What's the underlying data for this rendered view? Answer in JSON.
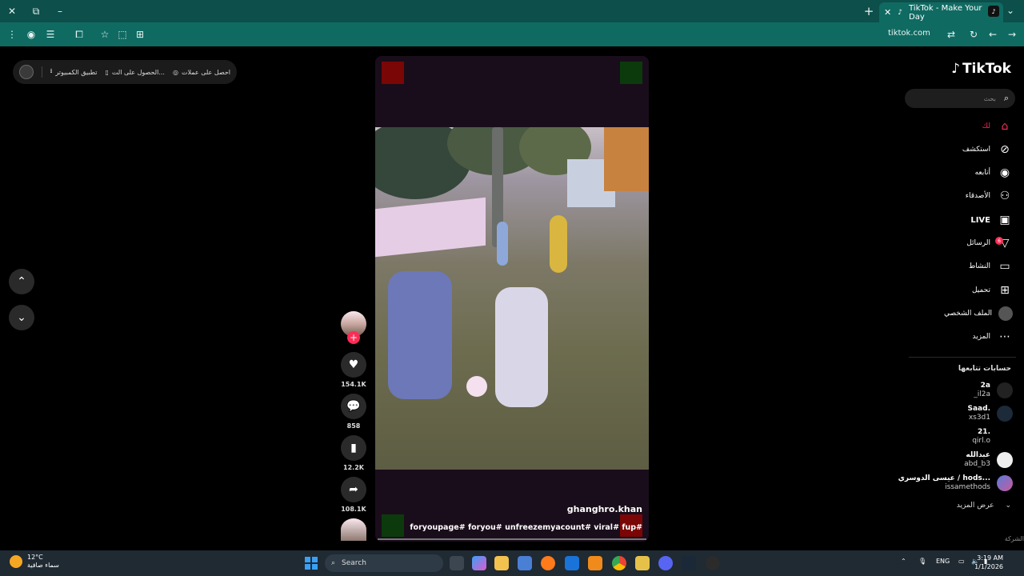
{
  "browser": {
    "tab_title": "TikTok - Make Your Day",
    "url": "tiktok.com"
  },
  "top_pill": {
    "item1": "احصل على عملات",
    "item2": "الحصول على الت...",
    "item3": "تطبيق الكمبيوتر"
  },
  "video": {
    "username": "ghanghro.khan",
    "caption": "foryoupage# foryou# unfreezemyacount# viral# fup#"
  },
  "actions": {
    "likes": "154.1K",
    "comments": "858",
    "saves": "12.2K",
    "shares": "108.1K"
  },
  "sidebar": {
    "logo": "TikTok",
    "search_placeholder": "بحث",
    "nav": [
      {
        "label": "لك",
        "icon": "home-icon"
      },
      {
        "label": "استكشف",
        "icon": "compass-icon"
      },
      {
        "label": "أتابعه",
        "icon": "following-icon"
      },
      {
        "label": "الأصدقاء",
        "icon": "friends-icon"
      },
      {
        "label": "LIVE",
        "icon": "live-icon"
      },
      {
        "label": "الرسائل",
        "icon": "messages-icon"
      },
      {
        "label": "النشاط",
        "icon": "activity-icon"
      },
      {
        "label": "تحميل",
        "icon": "upload-icon"
      },
      {
        "label": "الملف الشخصي",
        "icon": "profile-icon"
      },
      {
        "label": "المزيد",
        "icon": "more-icon"
      }
    ],
    "messages_badge": "6",
    "following_title": "حسابات تتابعها",
    "following": [
      {
        "name": "2a",
        "user": "_il2a"
      },
      {
        "name": "Saad.",
        "user": "xs3d1"
      },
      {
        "name": "21.",
        "user": "qirl.o"
      },
      {
        "name": "عبدالله",
        "user": "abd_b3"
      },
      {
        "name": "عيسى الدوسري / hods...",
        "user": "issamethods"
      }
    ],
    "see_more": "عرض المزيد",
    "company": "الشركة"
  },
  "taskbar": {
    "temp": "12°C",
    "weather": "سماء صافية",
    "search": "Search",
    "lang": "ENG",
    "time": "3:19 AM",
    "date": "1/1/2026"
  },
  "colors": {
    "accent": "#fe2c55",
    "chrome": "#0f6a62"
  }
}
